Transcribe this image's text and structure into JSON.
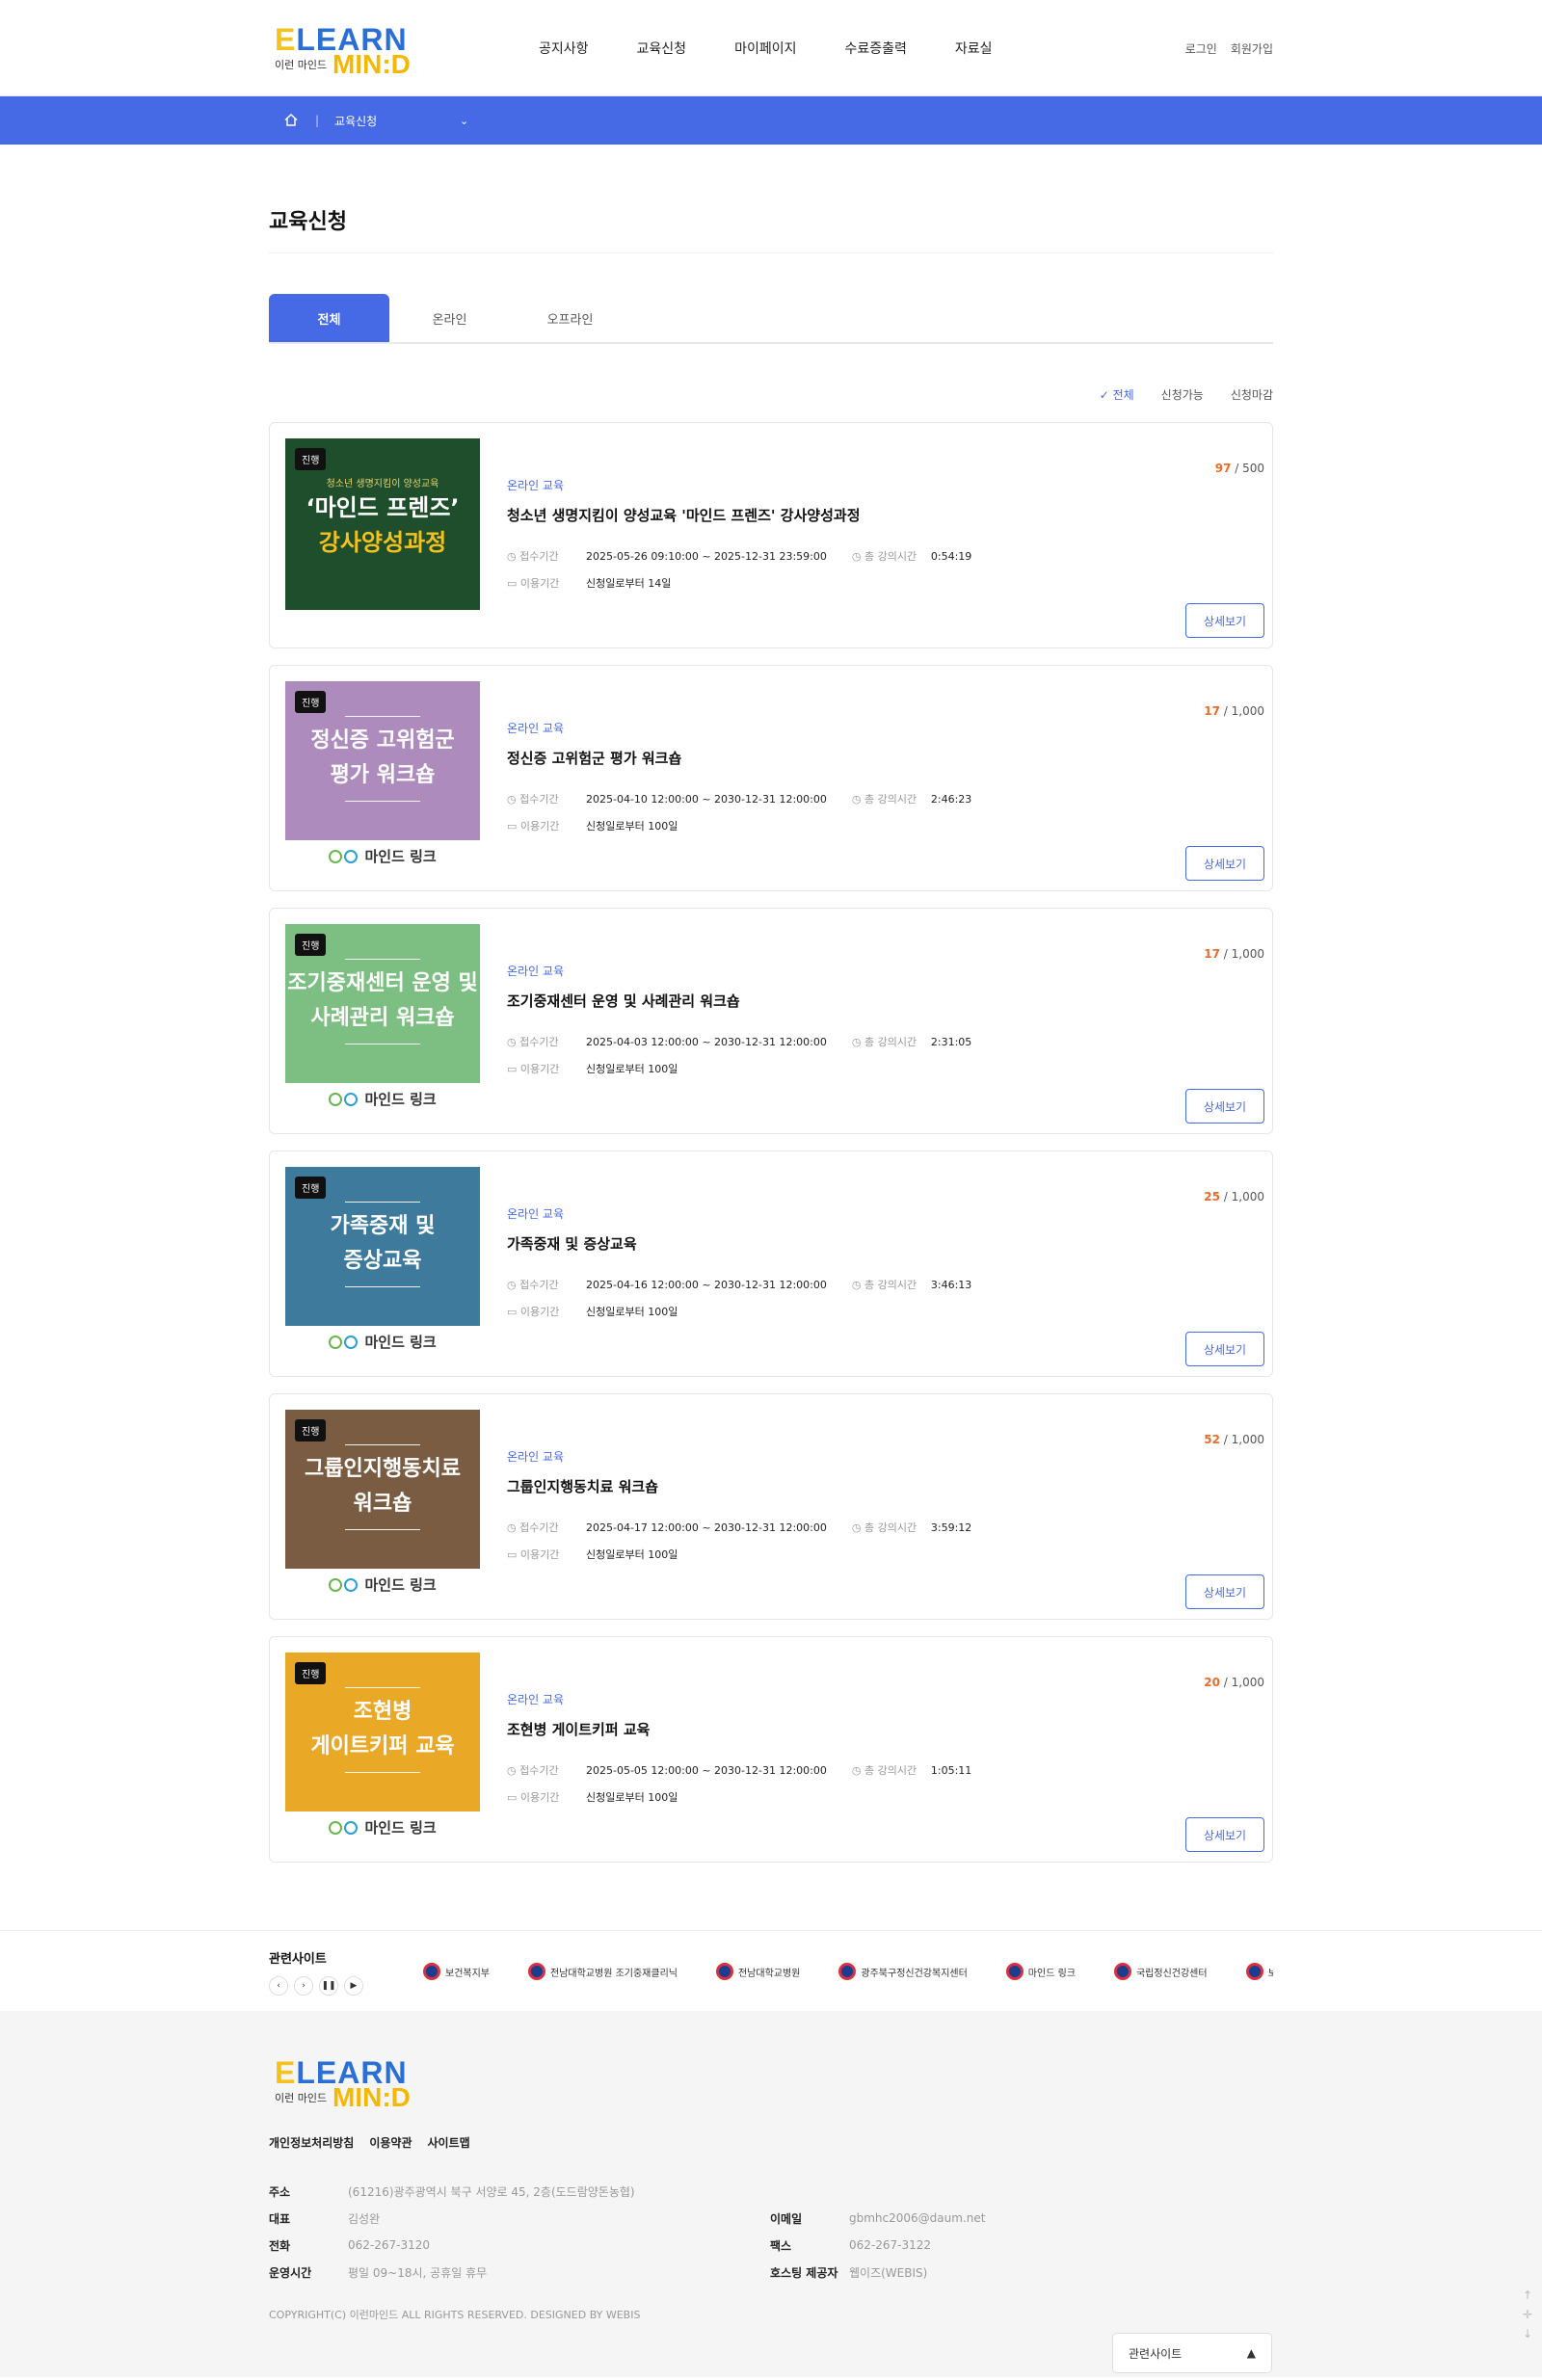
{
  "header": {
    "logo": {
      "top": "E LEARN",
      "sub": "이런 마인드",
      "brand": "MIN:D"
    },
    "nav": [
      "공지사항",
      "교육신청",
      "마이페이지",
      "수료증출력",
      "자료실"
    ],
    "util": [
      "로그인",
      "회원가입"
    ]
  },
  "location": {
    "current": "교육신청"
  },
  "page": {
    "title": "교육신청"
  },
  "tabs": [
    "전체",
    "온라인",
    "오프라인"
  ],
  "filters": [
    "전체",
    "신청가능",
    "신청마감"
  ],
  "labels": {
    "period": "접수기간",
    "duration": "총 강의시간",
    "usage": "이용기간",
    "detail": "상세보기",
    "badge": "진행"
  },
  "courses": [
    {
      "thumb_color": "#1f4e2c",
      "thumb_lines": [
        "‘마인드 프렌즈’",
        "강사양성과정"
      ],
      "thumb_sub": "청소년 생명지킴이 양성교육",
      "category": "온라인 교육",
      "title": "청소년 생명지킴이 양성교육 '마인드 프렌즈' 강사양성과정",
      "count": "97",
      "total": "500",
      "period": "2025-05-26 09:10:00 ~ 2025-12-31 23:59:00",
      "duration": "0:54:19",
      "usage": "신청일로부터 14일"
    },
    {
      "thumb_color": "#ae8bbd",
      "thumb_lines": [
        "정신증 고위험군",
        "평가 워크숍"
      ],
      "category": "온라인 교육",
      "title": "정신증 고위험군 평가 워크숍",
      "count": "17",
      "total": "1,000",
      "period": "2025-04-10 12:00:00 ~ 2030-12-31 12:00:00",
      "duration": "2:46:23",
      "usage": "신청일로부터 100일"
    },
    {
      "thumb_color": "#7dbf82",
      "thumb_lines": [
        "조기중재센터 운영 및",
        "사례관리 워크숍"
      ],
      "category": "온라인 교육",
      "title": "조기중재센터 운영 및 사례관리 워크숍",
      "count": "17",
      "total": "1,000",
      "period": "2025-04-03 12:00:00 ~ 2030-12-31 12:00:00",
      "duration": "2:31:05",
      "usage": "신청일로부터 100일"
    },
    {
      "thumb_color": "#3d7a9c",
      "thumb_lines": [
        "가족중재 및",
        "증상교육"
      ],
      "category": "온라인 교육",
      "title": "가족중재 및 증상교육",
      "count": "25",
      "total": "1,000",
      "period": "2025-04-16 12:00:00 ~ 2030-12-31 12:00:00",
      "duration": "3:46:13",
      "usage": "신청일로부터 100일"
    },
    {
      "thumb_color": "#7a5c42",
      "thumb_lines": [
        "그룹인지행동치료",
        "워크숍"
      ],
      "category": "온라인 교육",
      "title": "그룹인지행동치료 워크숍",
      "count": "52",
      "total": "1,000",
      "period": "2025-04-17 12:00:00 ~ 2030-12-31 12:00:00",
      "duration": "3:59:12",
      "usage": "신청일로부터 100일"
    },
    {
      "thumb_color": "#e9a825",
      "thumb_lines": [
        "조현병",
        "게이트키퍼 교육"
      ],
      "category": "온라인 교육",
      "title": "조현병 게이트키퍼 교육",
      "count": "20",
      "total": "1,000",
      "period": "2025-05-05 12:00:00 ~ 2030-12-31 12:00:00",
      "duration": "1:05:11",
      "usage": "신청일로부터 100일"
    }
  ],
  "thumb_brand": "마인드 링크",
  "related": {
    "title": "관련사이트",
    "logos": [
      "보건복지부",
      "전남대학교병원 조기중재클리닉",
      "전남대학교병원",
      "광주북구정신건강복지센터",
      "마인드 링크",
      "국립정신건강센터",
      "보건"
    ]
  },
  "footer": {
    "links": [
      "개인정보처리방침",
      "이용약관",
      "사이트맵"
    ],
    "left": [
      {
        "k": "주소",
        "v": "(61216)광주광역시 북구 서양로 45, 2층(도드람양돈농협)"
      },
      {
        "k": "대표",
        "v": "김성완"
      },
      {
        "k": "전화",
        "v": "062-267-3120"
      },
      {
        "k": "운영시간",
        "v": "평일 09~18시, 공휴일 휴무"
      }
    ],
    "right": [
      {
        "k": "이메일",
        "v": "gbmhc2006@daum.net"
      },
      {
        "k": "팩스",
        "v": "062-267-3122"
      },
      {
        "k": "호스팅 제공자",
        "v": "웹이즈(WEBIS)"
      }
    ],
    "copyright": "COPYRIGHT(C) 이런마인드 ALL RIGHTS RESERVED. DESIGNED BY WEBIS",
    "family_site": "관련사이트"
  }
}
